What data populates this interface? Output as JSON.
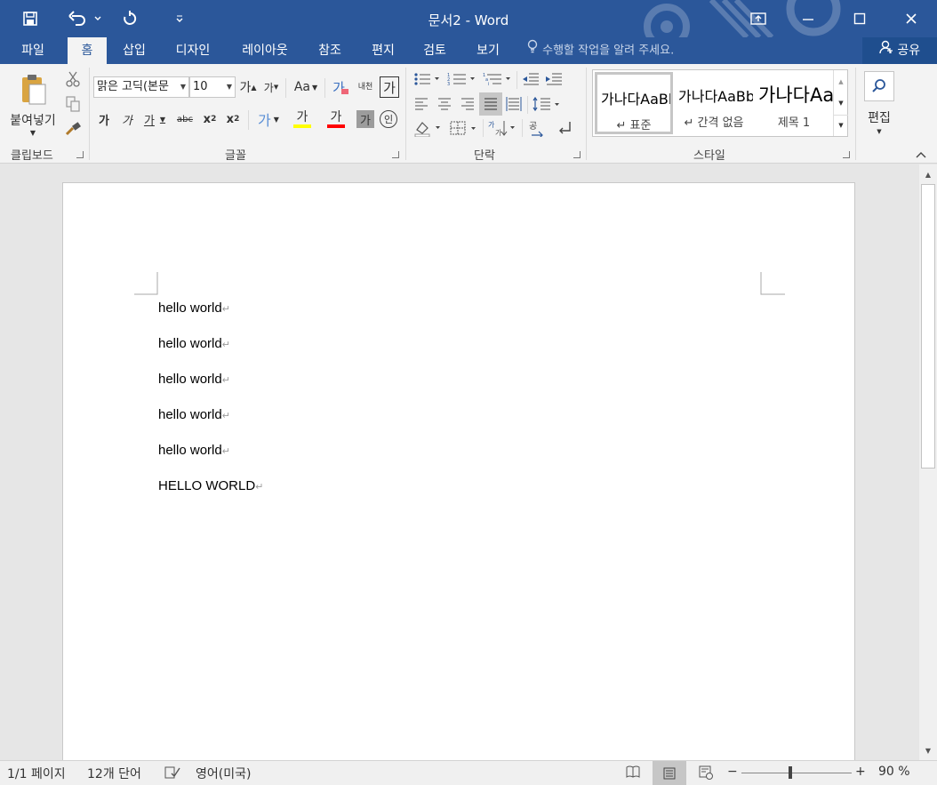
{
  "window": {
    "title": "문서2 - Word",
    "quick_access": [
      "save-icon",
      "undo-icon",
      "redo-icon",
      "customize-icon"
    ],
    "controls": [
      "ribbon-display-icon",
      "minimize-icon",
      "maximize-icon",
      "close-icon"
    ]
  },
  "tabs": [
    "파일",
    "홈",
    "삽입",
    "디자인",
    "레이아웃",
    "참조",
    "편지",
    "검토",
    "보기"
  ],
  "active_tab": "홈",
  "tell_me": "수행할 작업을 알려 주세요.",
  "share": "공유",
  "ribbon": {
    "clipboard": {
      "label": "클립보드",
      "paste": "붙여넣기"
    },
    "font": {
      "label": "글꼴",
      "font_name": "맑은 고딕(본문",
      "font_size": "10",
      "grow": "가",
      "shrink": "가",
      "change_case": "Aa",
      "clear_format": "가",
      "phonetic": "내천",
      "char_border": "가",
      "bold": "가",
      "italic": "가",
      "underline": "가",
      "strike": "abc",
      "subscript": "x",
      "subscript_mark": "2",
      "superscript": "x",
      "superscript_mark": "2",
      "text_effects": "가",
      "highlight": "가",
      "font_color": "가",
      "shading": "가",
      "enclose": "인"
    },
    "paragraph": {
      "label": "단락"
    },
    "styles": {
      "label": "스타일",
      "items": [
        {
          "sample": "가나다AaBb",
          "name": "↵ 표준"
        },
        {
          "sample": "가나다AaBb",
          "name": "↵ 간격 없음"
        },
        {
          "sample": "가나다Aa",
          "name": "제목 1"
        }
      ]
    },
    "editing": {
      "label": "편집"
    }
  },
  "document": {
    "lines": [
      "hello world",
      "hello world",
      "hello world",
      "hello world",
      "hello world",
      "HELLO WORLD"
    ],
    "mark": "↵"
  },
  "status": {
    "page": "1/1 페이지",
    "words": "12개 단어",
    "language": "영어(미국)",
    "zoom": "90 %",
    "zoom_minus": "−",
    "zoom_plus": "+"
  },
  "colors": {
    "brand": "#2b579a",
    "highlight_bar": "#ffff00",
    "font_color_bar": "#ff0000"
  }
}
